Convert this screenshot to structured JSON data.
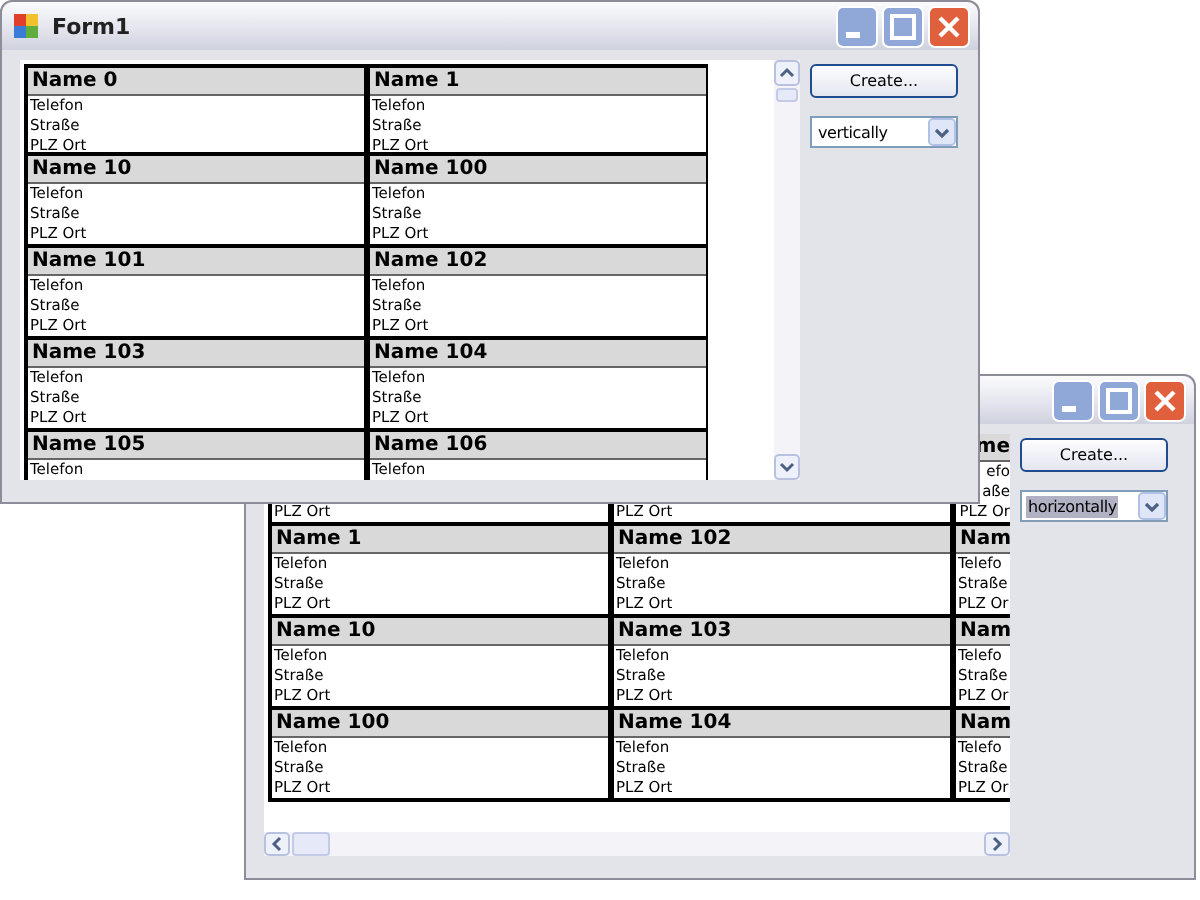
{
  "windows": [
    {
      "kind": "front",
      "title": "Form1",
      "scroll": {
        "kind": "vertical"
      },
      "create_button": "Create...",
      "orientation": {
        "value": "vertically",
        "focused": false
      },
      "rows": [
        [
          {
            "kind": "full",
            "name": "Name 0",
            "lines": [
              "Telefon",
              "Straße",
              "PLZ Ort"
            ]
          },
          {
            "kind": "full",
            "name": "Name 1",
            "lines": [
              "Telefon",
              "Straße",
              "PLZ Ort"
            ]
          }
        ],
        [
          {
            "kind": "full",
            "name": "Name 10",
            "lines": [
              "Telefon",
              "Straße",
              "PLZ Ort"
            ]
          },
          {
            "kind": "full",
            "name": "Name 100",
            "lines": [
              "Telefon",
              "Straße",
              "PLZ Ort"
            ]
          }
        ],
        [
          {
            "kind": "full",
            "name": "Name 101",
            "lines": [
              "Telefon",
              "Straße",
              "PLZ Ort"
            ]
          },
          {
            "kind": "full",
            "name": "Name 102",
            "lines": [
              "Telefon",
              "Straße",
              "PLZ Ort"
            ]
          }
        ],
        [
          {
            "kind": "full",
            "name": "Name 103",
            "lines": [
              "Telefon",
              "Straße",
              "PLZ Ort"
            ]
          },
          {
            "kind": "full",
            "name": "Name 104",
            "lines": [
              "Telefon",
              "Straße",
              "PLZ Ort"
            ]
          }
        ],
        [
          {
            "kind": "full",
            "name": "Name 105",
            "lines": [
              "Telefon"
            ]
          },
          {
            "kind": "full",
            "name": "Name 106",
            "lines": [
              "Telefon"
            ]
          }
        ]
      ]
    },
    {
      "kind": "back",
      "scroll": {
        "kind": "horizontal"
      },
      "create_button": "Create...",
      "orientation": {
        "value": "horizontally",
        "focused": true
      },
      "rows": [
        [
          {
            "kind": "tail",
            "lines": [
              "PLZ Ort"
            ]
          },
          {
            "kind": "tail",
            "lines": [
              "PLZ Ort"
            ]
          },
          {
            "kind": "clipped",
            "name": "me",
            "lines": [
              "efo",
              "aße",
              "PLZ Or"
            ]
          }
        ],
        [
          {
            "kind": "full",
            "name": "Name 1",
            "lines": [
              "Telefon",
              "Straße",
              "PLZ Ort"
            ]
          },
          {
            "kind": "full",
            "name": "Name 102",
            "lines": [
              "Telefon",
              "Straße",
              "PLZ Ort"
            ]
          },
          {
            "kind": "full",
            "name": "Nam",
            "lines": [
              "Telefo",
              "Straße",
              "PLZ Or"
            ]
          }
        ],
        [
          {
            "kind": "full",
            "name": "Name 10",
            "lines": [
              "Telefon",
              "Straße",
              "PLZ Ort"
            ]
          },
          {
            "kind": "full",
            "name": "Name 103",
            "lines": [
              "Telefon",
              "Straße",
              "PLZ Ort"
            ]
          },
          {
            "kind": "full",
            "name": "Nam",
            "lines": [
              "Telefo",
              "Straße",
              "PLZ Or"
            ]
          }
        ],
        [
          {
            "kind": "full",
            "name": "Name 100",
            "lines": [
              "Telefon",
              "Straße",
              "PLZ Ort"
            ]
          },
          {
            "kind": "full",
            "name": "Name 104",
            "lines": [
              "Telefon",
              "Straße",
              "PLZ Ort"
            ]
          },
          {
            "kind": "full",
            "name": "Nam",
            "lines": [
              "Telefo",
              "Straße",
              "PLZ Or"
            ]
          }
        ]
      ]
    }
  ]
}
